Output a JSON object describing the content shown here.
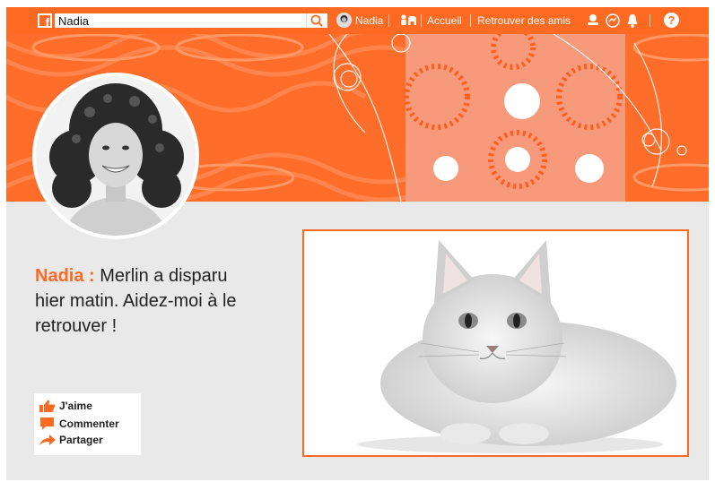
{
  "topbar": {
    "logo": "f",
    "search_value": "Nadia",
    "profile_name": "Nadia",
    "home_label": "Accueil",
    "find_friends_label": "Retrouver des amis",
    "help_label": "?"
  },
  "colors": {
    "brand": "#ff6a22",
    "cover_panel": "#f79a7c",
    "page_background": "#e9e9e9"
  },
  "icons": [
    "facebook-logo-icon",
    "search-icon",
    "friends-icon",
    "friend-requests-icon",
    "messenger-icon",
    "bell-icon",
    "help-icon",
    "thumbs-up-icon",
    "comment-icon",
    "share-icon"
  ],
  "post": {
    "author": "Nadia :",
    "text": "Merlin a disparu hier matin. Aidez-moi à le retrouver !"
  },
  "actions": {
    "like": "J'aime",
    "comment": "Commenter",
    "share": "Partager"
  }
}
